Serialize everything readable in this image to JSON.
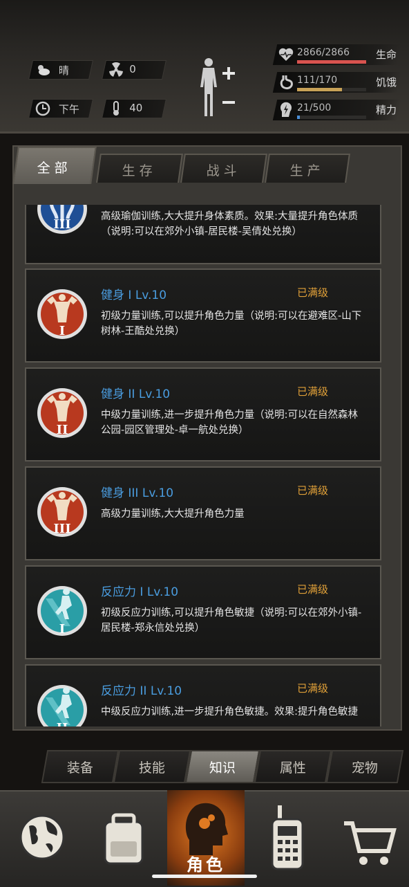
{
  "status": {
    "weather": "晴",
    "radiation": "0",
    "time": "下午",
    "temperature": "40"
  },
  "bars": {
    "health": {
      "value": "2866/2866",
      "label": "生命",
      "fraction": 1.0,
      "color": "#d9534f"
    },
    "hunger": {
      "value": "111/170",
      "label": "饥饿",
      "fraction": 0.653,
      "color": "#c8a257"
    },
    "energy": {
      "value": "21/500",
      "label": "精力",
      "fraction": 0.042,
      "color": "#4a8fd8"
    }
  },
  "tabs": [
    "全部",
    "生存",
    "战斗",
    "生产"
  ],
  "cards": [
    {
      "name": "",
      "level": "",
      "desc": "高级瑜伽训练,大大提升身体素质。效果:大量提升角色体质（说明:可以在郊外小镇-居民楼-吴倩处兑换）",
      "badge": "yoga-icon",
      "roman": "III"
    },
    {
      "name": "健身 I Lv.10",
      "level": "已满级",
      "desc": "初级力量训练,可以提升角色力量（说明:可以在避难区-山下树林-王酷处兑换）",
      "badge": "fitness-icon",
      "roman": "I"
    },
    {
      "name": "健身 II Lv.10",
      "level": "已满级",
      "desc": "中级力量训练,进一步提升角色力量（说明:可以在自然森林公园-园区管理处-卓一航处兑换）",
      "badge": "fitness-icon",
      "roman": "II"
    },
    {
      "name": "健身 III Lv.10",
      "level": "已满级",
      "desc": "高级力量训练,大大提升角色力量",
      "badge": "fitness-icon",
      "roman": "III"
    },
    {
      "name": "反应力 I Lv.10",
      "level": "已满级",
      "desc": "初级反应力训练,可以提升角色敏捷（说明:可以在郊外小镇-居民楼-郑永信处兑换）",
      "badge": "reflex-icon",
      "roman": "I"
    },
    {
      "name": "反应力 II Lv.10",
      "level": "已满级",
      "desc": "中级反应力训练,进一步提升角色敏捷。效果:提升角色敏捷",
      "badge": "reflex-icon",
      "roman": "II"
    }
  ],
  "subnav": [
    "装备",
    "技能",
    "知识",
    "属性",
    "宠物"
  ],
  "bottom_nav": {
    "active_label": "角色"
  },
  "colors": {
    "blue_name": "#4a9de0",
    "orange_level": "#e0a038"
  }
}
